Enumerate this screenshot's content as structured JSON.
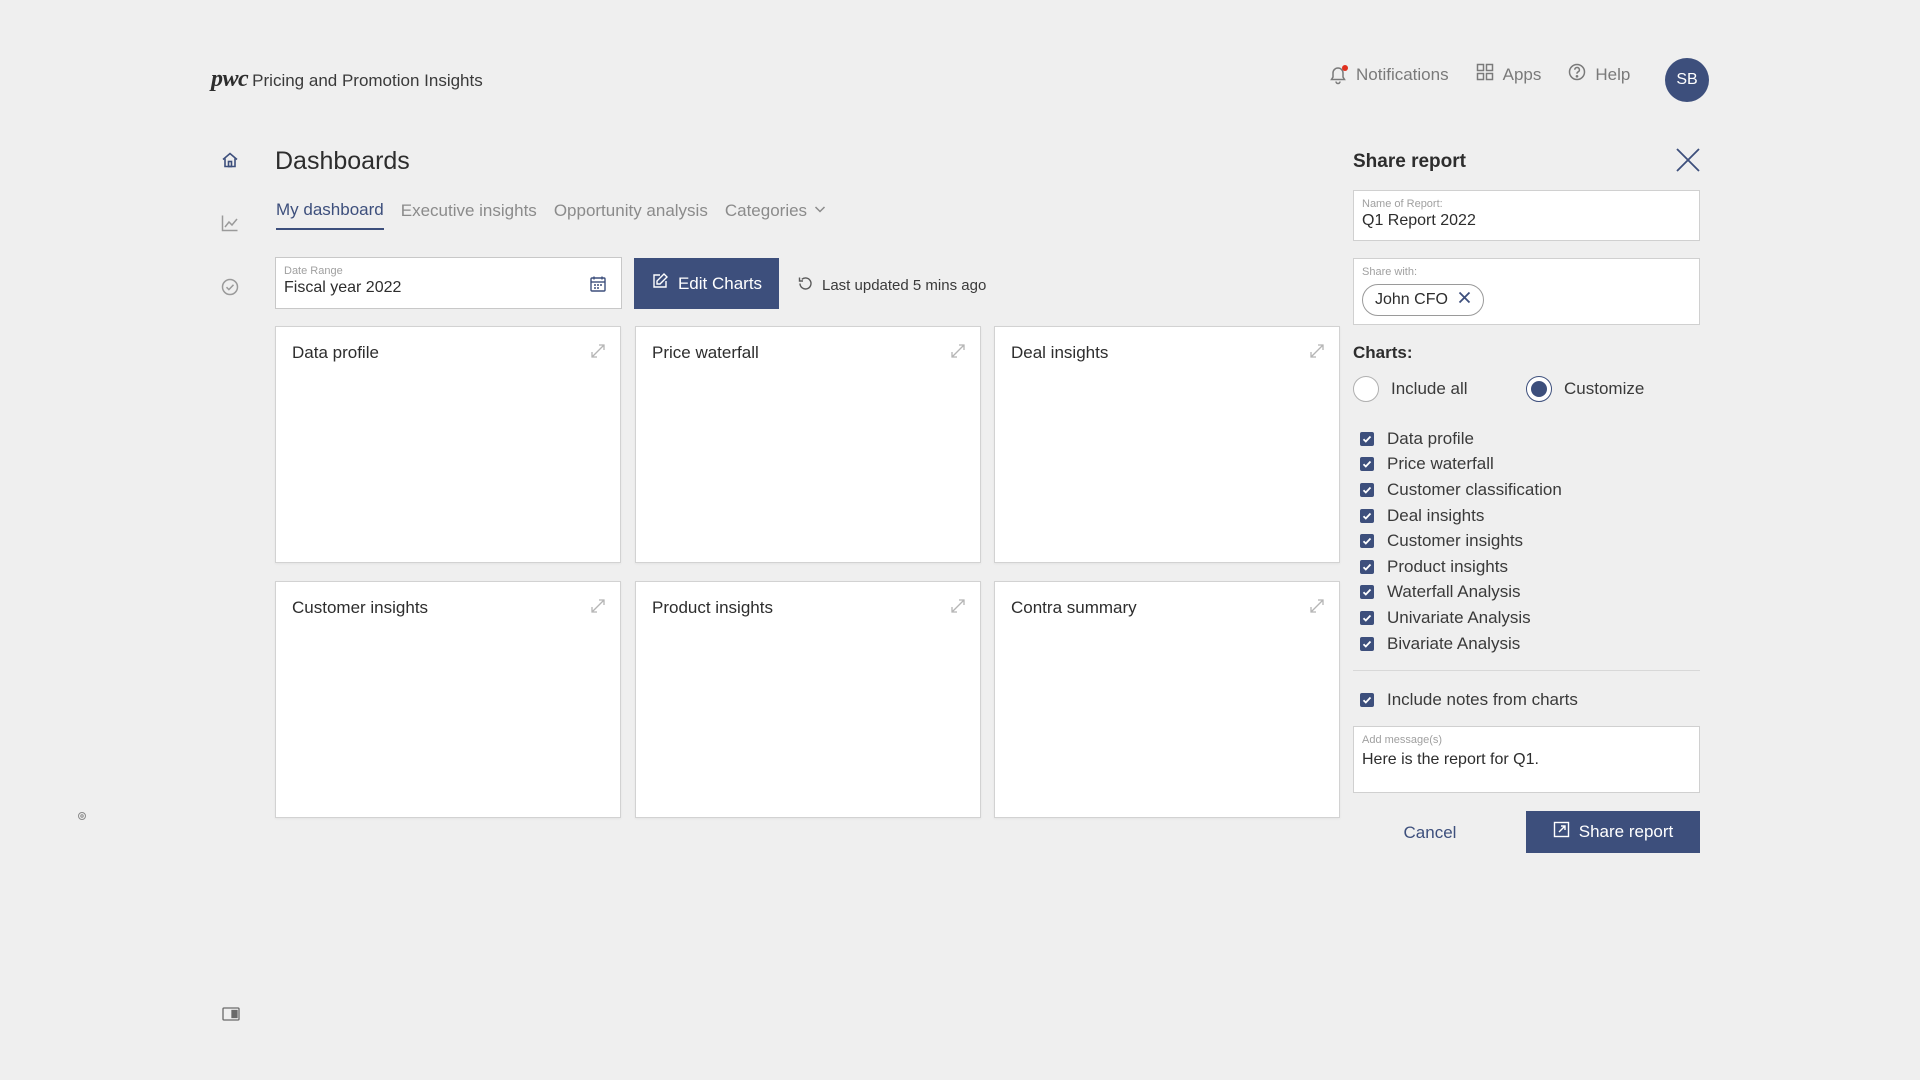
{
  "header": {
    "logo": "pwc",
    "app_name": "Pricing and Promotion Insights",
    "nav": [
      {
        "label": "Notifications",
        "icon": "bell-icon"
      },
      {
        "label": "Apps",
        "icon": "grid-icon"
      },
      {
        "label": "Help",
        "icon": "help-circle-icon"
      }
    ],
    "avatar": "SB"
  },
  "sidebar": {
    "icons": [
      "home-icon",
      "line-chart-icon",
      "check-circle-icon",
      "panel-toggle-icon"
    ]
  },
  "dashboard": {
    "title": "Dashboards",
    "tabs": [
      {
        "label": "My dashboard",
        "active": true
      },
      {
        "label": "Executive insights"
      },
      {
        "label": "Opportunity analysis"
      },
      {
        "label": "Categories"
      }
    ],
    "date_range": {
      "label": "Date Range",
      "value": "Fiscal year 2022"
    },
    "edit_charts_label": "Edit Charts",
    "last_updated": "Last updated 5 mins ago",
    "cards": [
      {
        "title": "Data profile"
      },
      {
        "title": "Price waterfall"
      },
      {
        "title": "Deal insights"
      },
      {
        "title": "Customer insights"
      },
      {
        "title": "Product insights"
      },
      {
        "title": "Contra summary"
      }
    ]
  },
  "share_panel": {
    "title": "Share report",
    "report_name": {
      "label": "Name of Report:",
      "value": "Q1 Report 2022"
    },
    "share_with": {
      "label": "Share with:",
      "chips": [
        "John CFO"
      ]
    },
    "charts_label": "Charts:",
    "radio": {
      "include_all": "Include all",
      "customize": "Customize",
      "selected": "customize"
    },
    "charts": [
      {
        "label": "Data profile",
        "checked": true
      },
      {
        "label": "Price waterfall",
        "checked": true
      },
      {
        "label": "Customer classification",
        "checked": true
      },
      {
        "label": "Deal insights",
        "checked": true
      },
      {
        "label": "Customer insights",
        "checked": true
      },
      {
        "label": "Product insights",
        "checked": true
      },
      {
        "label": "Waterfall Analysis",
        "checked": true
      },
      {
        "label": "Univariate Analysis",
        "checked": true
      },
      {
        "label": "Bivariate Analysis",
        "checked": true
      }
    ],
    "include_notes": {
      "label": "Include notes from charts",
      "checked": true
    },
    "message": {
      "label": "Add message(s)",
      "value": "Here is the report for Q1."
    },
    "cancel_label": "Cancel",
    "share_label": "Share report"
  },
  "colors": {
    "primary": "#3d4f7c",
    "background": "#efefef",
    "notification_dot": "#e0301e"
  }
}
